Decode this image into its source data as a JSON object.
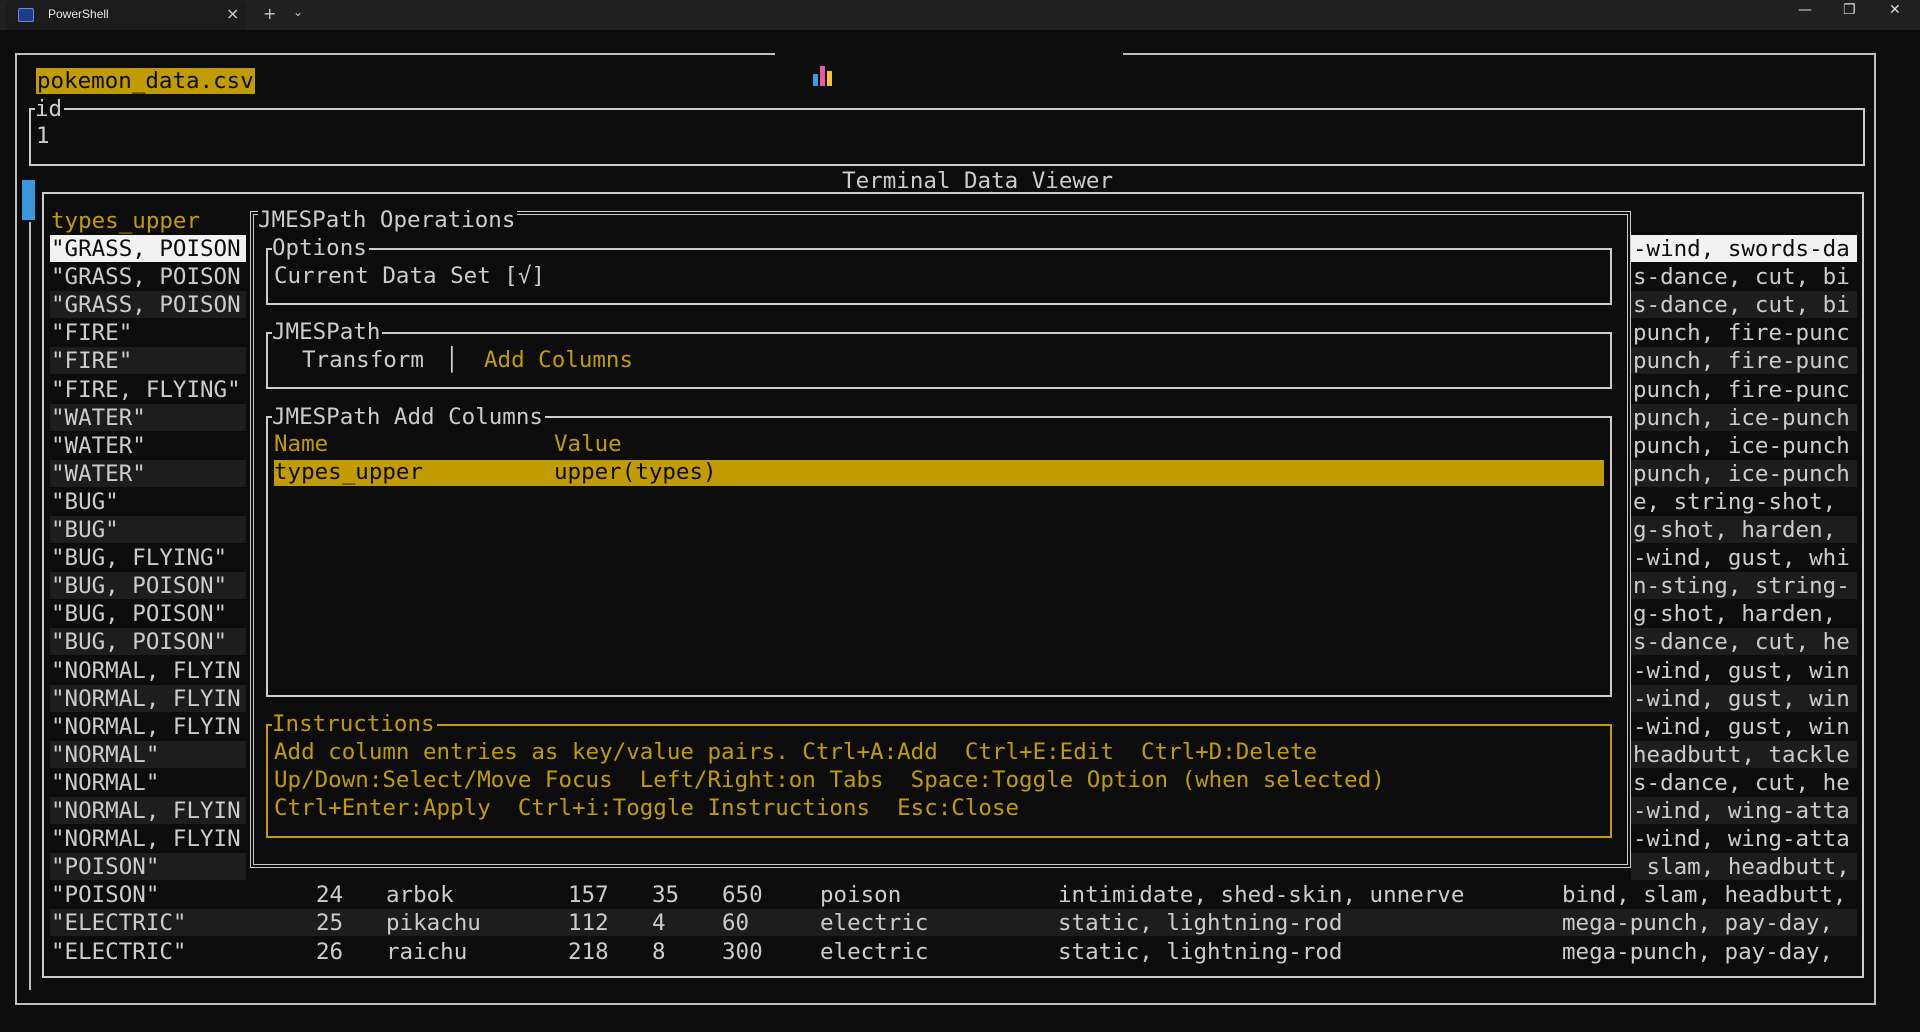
{
  "window": {
    "tab_title": "PowerShell",
    "tab_close": "×",
    "new_tab": "+",
    "tab_dropdown": "⌄",
    "minimize": "—",
    "restore": "❐",
    "close": "✕"
  },
  "app": {
    "title": "Terminal Data Viewer",
    "filename": "pokemon_data.csv"
  },
  "field": {
    "label": "id",
    "value": "1"
  },
  "table": {
    "header_left": "types_upper",
    "left_col": [
      "\"GRASS, POISON",
      "\"GRASS, POISON",
      "\"GRASS, POISON",
      "\"FIRE\"",
      "\"FIRE\"",
      "\"FIRE, FLYING\"",
      "\"WATER\"",
      "\"WATER\"",
      "\"WATER\"",
      "\"BUG\"",
      "\"BUG\"",
      "\"BUG, FLYING\"",
      "\"BUG, POISON\"",
      "\"BUG, POISON\"",
      "\"BUG, POISON\"",
      "\"NORMAL, FLYIN",
      "\"NORMAL, FLYIN",
      "\"NORMAL, FLYIN",
      "\"NORMAL\"",
      "\"NORMAL\"",
      "\"NORMAL, FLYIN",
      "\"NORMAL, FLYIN",
      "\"POISON\""
    ],
    "right_col": [
      "-wind, swords-da",
      "s-dance, cut, bi",
      "s-dance, cut, bi",
      "punch, fire-punc",
      "punch, fire-punc",
      "punch, fire-punc",
      "punch, ice-punch",
      "punch, ice-punch",
      "punch, ice-punch",
      "e, string-shot,",
      "g-shot, harden,",
      "-wind, gust, whi",
      "n-sting, string-",
      "g-shot, harden,",
      "s-dance, cut, he",
      "-wind, gust, win",
      "-wind, gust, win",
      "-wind, gust, win",
      "headbutt, tackle",
      "s-dance, cut, he",
      "-wind, wing-atta",
      "-wind, wing-atta",
      " slam, headbutt,"
    ],
    "bottom_rows": [
      {
        "types": "\"POISON\"",
        "id": "24",
        "name": "arbok",
        "height": "157",
        "weight": "35",
        "exp": "650",
        "type": "poison",
        "abilities": "intimidate, shed-skin, unnerve",
        "moves": "bind, slam, headbutt,"
      },
      {
        "types": "\"ELECTRIC\"",
        "id": "25",
        "name": "pikachu",
        "height": "112",
        "weight": "4",
        "exp": "60",
        "type": "electric",
        "abilities": "static, lightning-rod",
        "moves": "mega-punch, pay-day,"
      },
      {
        "types": "\"ELECTRIC\"",
        "id": "26",
        "name": "raichu",
        "height": "218",
        "weight": "8",
        "exp": "300",
        "type": "electric",
        "abilities": "static, lightning-rod",
        "moves": "mega-punch, pay-day,"
      }
    ]
  },
  "modal": {
    "title": "JMESPath Operations",
    "options": {
      "label": "Options",
      "item": "Current Data Set [√]"
    },
    "jmespath": {
      "label": "JMESPath",
      "tab_transform": "Transform",
      "separator": "│",
      "tab_add_columns": "Add Columns"
    },
    "add_columns": {
      "label": "JMESPath Add Columns",
      "header_name": "Name",
      "header_value": "Value",
      "row_name": "types_upper",
      "row_value": "upper(types)"
    },
    "instructions": {
      "label": "Instructions",
      "line1": "Add column entries as key/value pairs. Ctrl+A:Add  Ctrl+E:Edit  Ctrl+D:Delete",
      "line2": "Up/Down:Select/Move Focus  Left/Right:on Tabs  Space:Toggle Option (when selected)",
      "line3": "Ctrl+Enter:Apply  Ctrl+i:Toggle Instructions  Esc:Close"
    }
  },
  "colors": {
    "accent": "#c19c00",
    "background": "#0c0c0c",
    "text": "#cccccc",
    "scroll": "#3a96dd"
  }
}
